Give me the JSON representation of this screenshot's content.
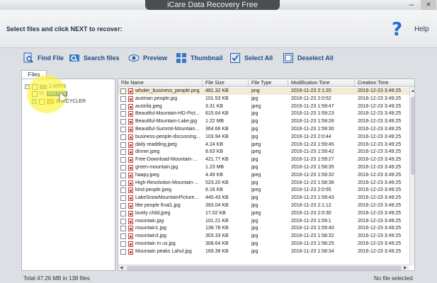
{
  "window": {
    "title": "iCare Data Recovery Free"
  },
  "header": {
    "instruction": "Select files and click NEXT to recover:",
    "help_label": "Help"
  },
  "toolbar": {
    "find_file": "Find File",
    "search_files": "Search files",
    "preview": "Preview",
    "thumbnail": "Thumbnail",
    "select_all": "Select All",
    "deselect_all": "Deselect All"
  },
  "tabs": {
    "files": "Files"
  },
  "tree": {
    "root": "1 NTFS",
    "child1": "lost files",
    "child1_prefix": "U:",
    "child2": "$RECYCLER"
  },
  "table": {
    "columns": [
      "File Name",
      "File Size",
      "File Type",
      "Modification Time",
      "Creation Time"
    ],
    "rows": [
      [
        "wholer_business_people.png",
        "481.32 KB",
        "png",
        "2016-11-23 2:1:20",
        "2016-12-23 3:49:25"
      ],
      [
        "austrian people.jpg",
        "101.53 KB",
        "jpg",
        "2016-11-23 2:0:52",
        "2016-12-23 3:49:25"
      ],
      [
        "austrila.jpeg",
        "3.31 KB",
        "jpeg",
        "2016-11-23 1:59:47",
        "2016-12-23 3:49:25"
      ],
      [
        "Beautiful-Mountain-HD-Pict...",
        "615.64 KB",
        "jpg",
        "2016-11-23 1:59:23",
        "2016-12-23 3:49:25"
      ],
      [
        "Beautiful-Mountain-Lake.jpg",
        "1.22 MB",
        "jpg",
        "2016-11-23 1:59:26",
        "2016-12-23 3:49:25"
      ],
      [
        "Beautiful-Summit-Mountain...",
        "364.66 KB",
        "jpg",
        "2016-11-23 1:59:30",
        "2016-12-23 3:49:25"
      ],
      [
        "business-people-discussing...",
        "103.94 KB",
        "jpg",
        "2016-11-23 2:0:44",
        "2016-12-23 3:49:25"
      ],
      [
        "daily readding.jpeg",
        "4.24 KB",
        "jpeg",
        "2016-11-23 1:59:45",
        "2016-12-23 3:49:25"
      ],
      [
        "dinner.jpeg",
        "8.63 KB",
        "jpeg",
        "2016-11-23 1:59:42",
        "2016-12-23 3:49:25"
      ],
      [
        "Free-Download-Mountain-...",
        "421.77 KB",
        "jpg",
        "2016-11-23 1:59:27",
        "2016-12-23 3:49:25"
      ],
      [
        "green-mountain.jpg",
        "1.23 MB",
        "jpg",
        "2016-11-23 1:58:35",
        "2016-12-23 3:49:25"
      ],
      [
        "haapy.jpeg",
        "4.49 KB",
        "jpeg",
        "2016-11-23 1:59:32",
        "2016-12-23 3:49:25"
      ],
      [
        "High-Resolution-Mountain-...",
        "523.20 KB",
        "jpg",
        "2016-11-23 1:58:38",
        "2016-12-23 3:49:25"
      ],
      [
        "kind people.jpeg",
        "6.16 KB",
        "jpeg",
        "2016-11-23 2:0:55",
        "2016-12-23 3:49:25"
      ],
      [
        "LakeSnowMountainPicture...",
        "445.43 KB",
        "jpg",
        "2016-11-23 1:59:43",
        "2016-12-23 3:49:25"
      ],
      [
        "litte people final1.jpg",
        "393.04 KB",
        "jpg",
        "2016-11-23 2:1:12",
        "2016-12-23 3:49:25"
      ],
      [
        "lovely child.jpeg",
        "17.02 KB",
        "jpeg",
        "2016-11-23 2:0:30",
        "2016-12-23 3:49:25"
      ],
      [
        "mountain.jpg",
        "101.21 KB",
        "jpg",
        "2016-11-23 1:59:1",
        "2016-12-23 3:49:25"
      ],
      [
        "mountain1.jpg",
        "138.78 KB",
        "jpg",
        "2016-11-23 1:59:40",
        "2016-12-23 3:49:25"
      ],
      [
        "mountain3.jpg",
        "303.33 KB",
        "jpg",
        "2016-11-23 1:58:32",
        "2016-12-23 3:49:25"
      ],
      [
        "mountain in us.jpg",
        "308.64 KB",
        "jpg",
        "2016-11-23 1:58:25",
        "2016-12-23 3:49:25"
      ],
      [
        "Mountain peaks Lahul.jpg",
        "169.39 KB",
        "jpg",
        "2016-11-23 1:58:34",
        "2016-12-23 3:49:25"
      ]
    ]
  },
  "status": {
    "left": "Total 47.26 MB in 138 files",
    "right": "No file selected"
  },
  "colors": {
    "accent": "#1f4d8a",
    "help": "#1e6fd0",
    "file_icon": "#c0392b",
    "highlight": "#faf628"
  }
}
